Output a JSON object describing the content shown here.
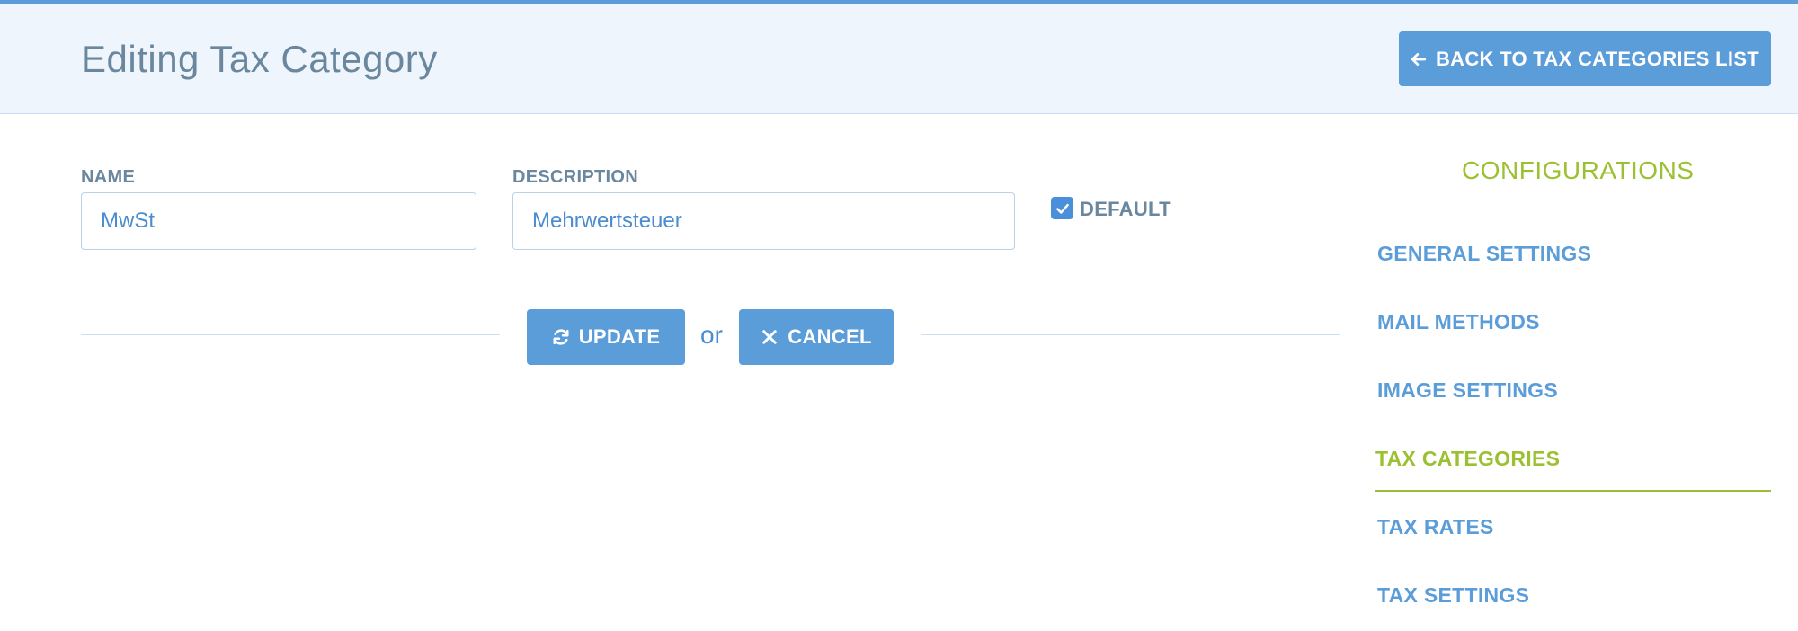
{
  "header": {
    "title": "Editing Tax Category",
    "back_button_label": "BACK TO TAX CATEGORIES LIST"
  },
  "form": {
    "name_label": "NAME",
    "name_value": "MwSt",
    "description_label": "DESCRIPTION",
    "description_value": "Mehrwertsteuer",
    "default_label": "DEFAULT",
    "default_checked": true,
    "update_label": "UPDATE",
    "or_text": "or",
    "cancel_label": "CANCEL"
  },
  "sidebar": {
    "heading": "CONFIGURATIONS",
    "items": [
      {
        "label": "GENERAL SETTINGS",
        "active": false
      },
      {
        "label": "MAIL METHODS",
        "active": false
      },
      {
        "label": "IMAGE SETTINGS",
        "active": false
      },
      {
        "label": "TAX CATEGORIES",
        "active": true
      },
      {
        "label": "TAX RATES",
        "active": false
      },
      {
        "label": "TAX SETTINGS",
        "active": false
      }
    ]
  },
  "colors": {
    "accent": "#5b9dd9",
    "active": "#9bc132",
    "label": "#6a879e",
    "header_bg": "#eff5fc"
  }
}
